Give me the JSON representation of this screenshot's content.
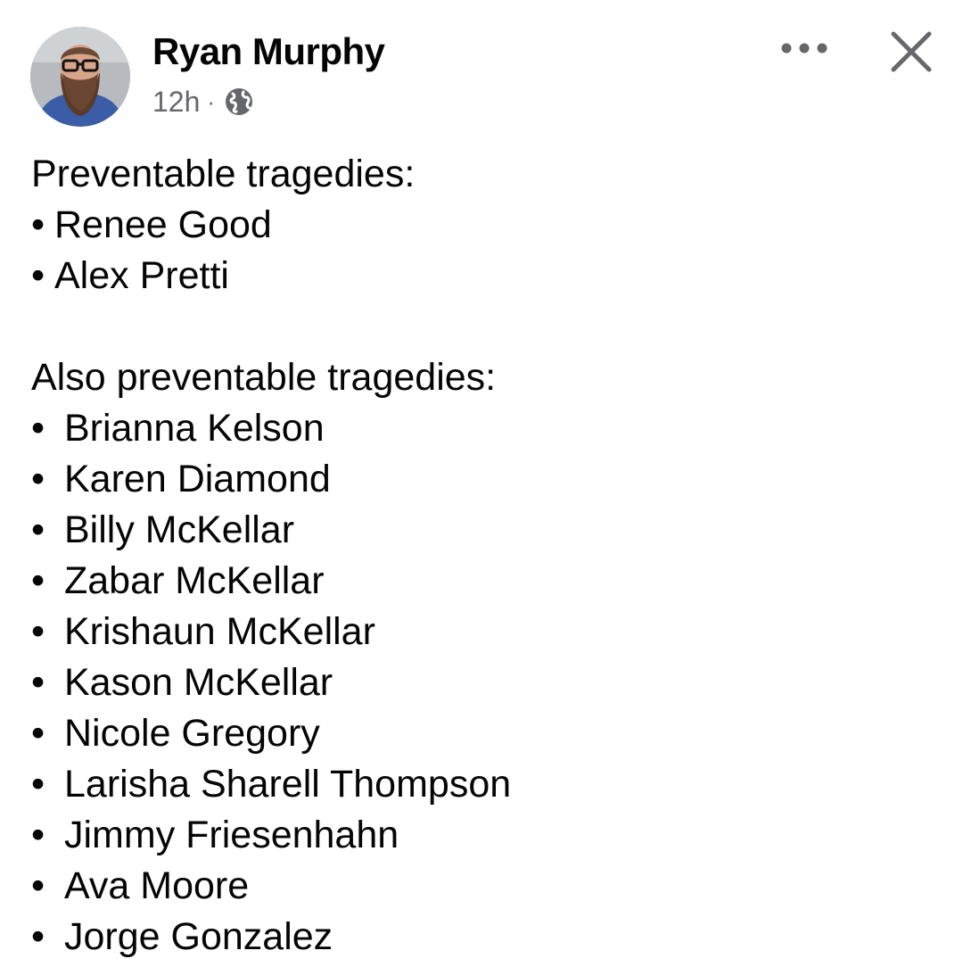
{
  "post": {
    "author": "Ryan Murphy",
    "time": "12h",
    "separator": "·",
    "audience_icon": "globe-icon",
    "more_icon": "more-horizontal-icon",
    "close_icon": "close-icon",
    "sections": [
      {
        "heading": "Preventable tragedies:",
        "items": [
          "Renee Good",
          "Alex Pretti"
        ]
      },
      {
        "heading": "Also preventable tragedies:",
        "items": [
          "Brianna Kelson",
          "Karen Diamond",
          "Billy McKellar",
          "Zabar McKellar",
          "Krishaun McKellar",
          "Kason McKellar",
          "Nicole Gregory",
          "Larisha Sharell Thompson",
          "Jimmy Friesenhahn",
          "Ava Moore",
          "Jorge Gonzalez"
        ]
      }
    ],
    "bullet_char": "•",
    "colors": {
      "text": "#050505",
      "meta": "#65676b",
      "icon": "#65676b"
    }
  }
}
